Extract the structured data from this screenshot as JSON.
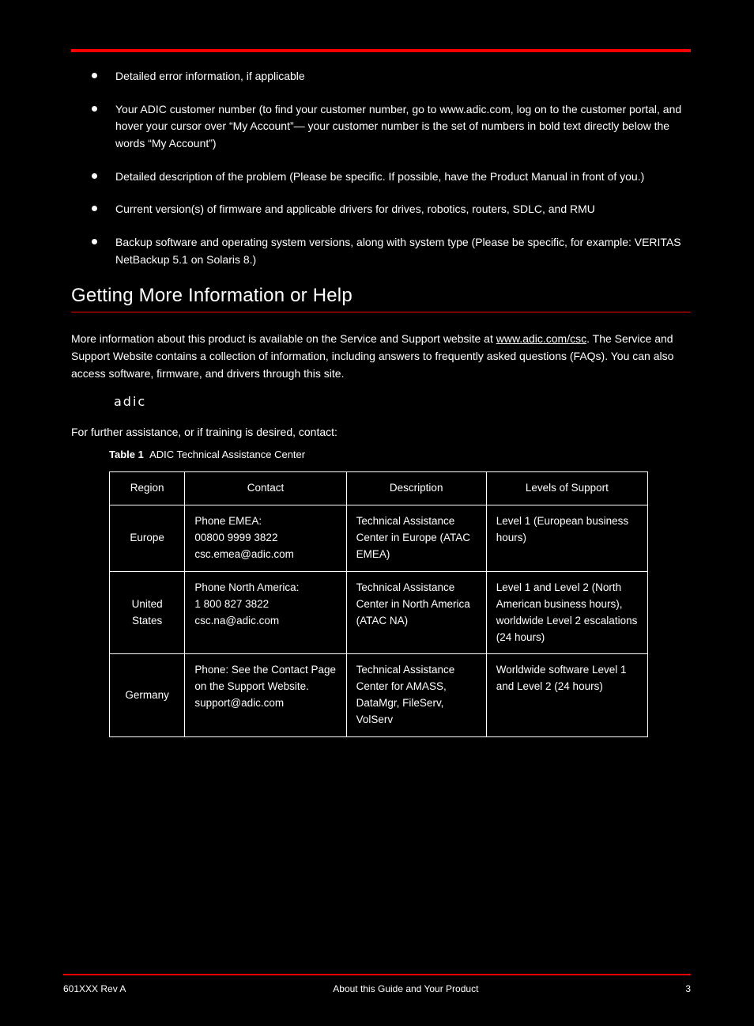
{
  "bullets": {
    "b1": "Detailed error information, if applicable",
    "b2": "Your ADIC customer number (to find your customer number, go to www.adic.com, log on to the customer portal, and hover your cursor over “My Account”— your customer number is the set of numbers in bold text directly below the words “My Account”)",
    "b3": "Detailed description of the problem (Please be specific. If possible, have the Product Manual in front of you.)",
    "b4": "Current version(s) of firmware and applicable drivers for drives, robotics, routers, SDLC, and RMU",
    "b5": "Backup software and operating system versions, along with system type (Please be specific, for example: VERITAS NetBackup 5.1 on Solaris 8.)"
  },
  "sectionTitle": "Getting More Information or Help",
  "intro": {
    "p1a": "More information about this product is available on the Service and Support website at ",
    "p1b": ". The Service and Support Website contains a collection of information, including answers to frequently asked questions (FAQs). You can also access software, firmware, and drivers through this site.",
    "url": "www.adic.com/csc",
    "p2": " For further assistance, or if training is desired, contact:",
    "logo": "adic"
  },
  "table": {
    "caption_label": "Table 1",
    "caption_text": "ADIC Technical Assistance Center",
    "headers": {
      "region": "Region",
      "contact": "Contact",
      "desc": "Description",
      "support": "Levels of Support"
    },
    "rows": [
      {
        "region": "Europe",
        "contact": "Phone EMEA:\n00800 9999 3822\ncsc.emea@adic.com",
        "desc": "Technical Assistance Center in Europe (ATAC EMEA)",
        "support": "Level 1 (European business hours)"
      },
      {
        "region": "United States",
        "contact": "Phone North America:\n1 800 827 3822\ncsc.na@adic.com",
        "desc": "Technical Assistance Center in North America (ATAC NA)",
        "support": "Level 1 and Level 2 (North American business hours), worldwide Level 2 escalations (24 hours)"
      },
      {
        "region": "Germany",
        "contact": "Phone: See the Contact Page on the Support Website.\nsupport@adic.com",
        "desc": "Technical Assistance Center for AMASS, DataMgr, FileServ, VolServ",
        "support": "Worldwide software Level 1 and Level 2 (24 hours)"
      }
    ]
  },
  "footer": {
    "doc": "601XXX Rev A",
    "title": "About this Guide and Your Product",
    "page": "3"
  }
}
